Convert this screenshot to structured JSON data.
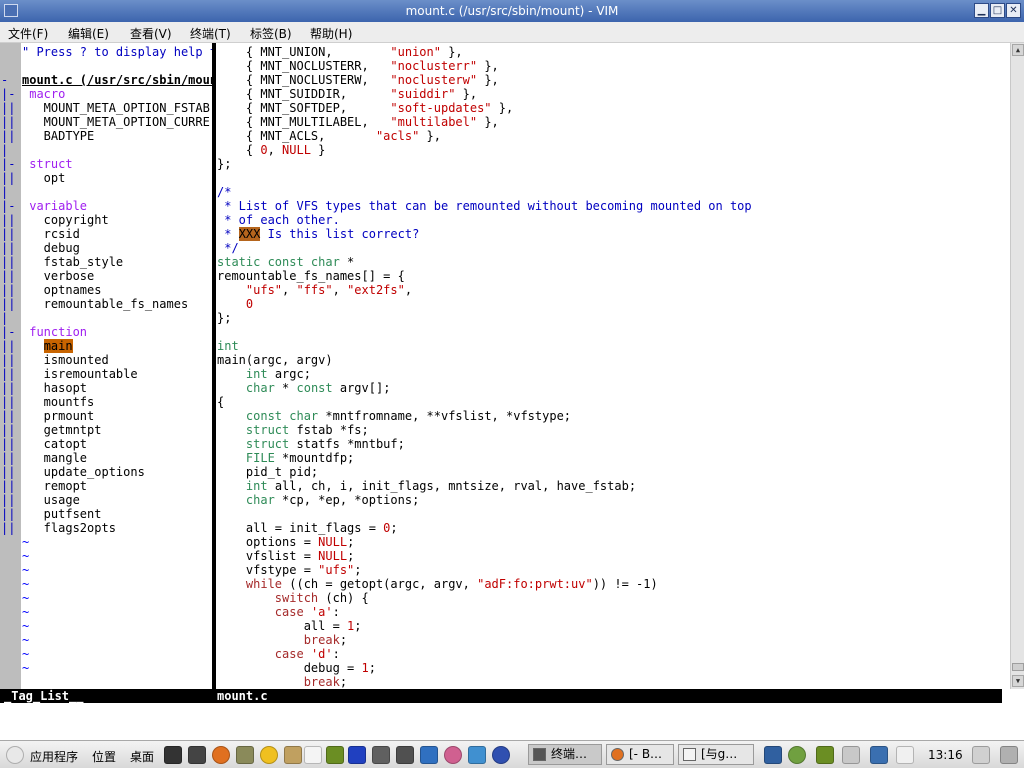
{
  "window": {
    "title": "mount.c (/usr/src/sbin/mount) - VIM",
    "controls": {
      "minimize": "▁",
      "maximize": "□",
      "close": "✕"
    }
  },
  "menu": [
    "文件(F)",
    "编辑(E)",
    "查看(V)",
    "终端(T)",
    "标签(B)",
    "帮助(H)"
  ],
  "taglist": {
    "lines": [
      {
        "fold": "",
        "text": "\" Press ? to display help t",
        "cls": "cmt"
      },
      {
        "fold": "",
        "text": "",
        "cls": ""
      },
      {
        "fold": "-",
        "text": "mount.c (/usr/src/sbin/moun",
        "cls": "hdr"
      },
      {
        "fold": "|-",
        "text": " macro",
        "cls": "tag-head"
      },
      {
        "fold": "||",
        "text": "   MOUNT_META_OPTION_FSTAB",
        "cls": ""
      },
      {
        "fold": "||",
        "text": "   MOUNT_META_OPTION_CURRE",
        "cls": ""
      },
      {
        "fold": "||",
        "text": "   BADTYPE",
        "cls": ""
      },
      {
        "fold": "|",
        "text": "",
        "cls": ""
      },
      {
        "fold": "|-",
        "text": " struct",
        "cls": "tag-head"
      },
      {
        "fold": "||",
        "text": "   opt",
        "cls": ""
      },
      {
        "fold": "|",
        "text": "",
        "cls": ""
      },
      {
        "fold": "|-",
        "text": " variable",
        "cls": "tag-head"
      },
      {
        "fold": "||",
        "text": "   copyright",
        "cls": ""
      },
      {
        "fold": "||",
        "text": "   rcsid",
        "cls": ""
      },
      {
        "fold": "||",
        "text": "   debug",
        "cls": ""
      },
      {
        "fold": "||",
        "text": "   fstab_style",
        "cls": ""
      },
      {
        "fold": "||",
        "text": "   verbose",
        "cls": ""
      },
      {
        "fold": "||",
        "text": "   optnames",
        "cls": ""
      },
      {
        "fold": "||",
        "text": "   remountable_fs_names",
        "cls": ""
      },
      {
        "fold": "|",
        "text": "",
        "cls": ""
      },
      {
        "fold": "|-",
        "text": " function",
        "cls": "tag-head"
      },
      {
        "fold": "||",
        "text": "   main",
        "cls": "cur"
      },
      {
        "fold": "||",
        "text": "   ismounted",
        "cls": ""
      },
      {
        "fold": "||",
        "text": "   isremountable",
        "cls": ""
      },
      {
        "fold": "||",
        "text": "   hasopt",
        "cls": ""
      },
      {
        "fold": "||",
        "text": "   mountfs",
        "cls": ""
      },
      {
        "fold": "||",
        "text": "   prmount",
        "cls": ""
      },
      {
        "fold": "||",
        "text": "   getmntpt",
        "cls": ""
      },
      {
        "fold": "||",
        "text": "   catopt",
        "cls": ""
      },
      {
        "fold": "||",
        "text": "   mangle",
        "cls": ""
      },
      {
        "fold": "||",
        "text": "   update_options",
        "cls": ""
      },
      {
        "fold": "||",
        "text": "   remopt",
        "cls": ""
      },
      {
        "fold": "||",
        "text": "   usage",
        "cls": ""
      },
      {
        "fold": "||",
        "text": "   putfsent",
        "cls": ""
      },
      {
        "fold": "||",
        "text": "   flags2opts",
        "cls": ""
      }
    ],
    "tilde": "~"
  },
  "code": [
    [
      [
        "    { MNT_UNION,        ",
        ""
      ],
      [
        "\"union\"",
        "str"
      ],
      [
        " },",
        ""
      ]
    ],
    [
      [
        "    { MNT_NOCLUSTERR,   ",
        ""
      ],
      [
        "\"noclusterr\"",
        "str"
      ],
      [
        " },",
        ""
      ]
    ],
    [
      [
        "    { MNT_NOCLUSTERW,   ",
        ""
      ],
      [
        "\"noclusterw\"",
        "str"
      ],
      [
        " },",
        ""
      ]
    ],
    [
      [
        "    { MNT_SUIDDIR,      ",
        ""
      ],
      [
        "\"suiddir\"",
        "str"
      ],
      [
        " },",
        ""
      ]
    ],
    [
      [
        "    { MNT_SOFTDEP,      ",
        ""
      ],
      [
        "\"soft-updates\"",
        "str"
      ],
      [
        " },",
        ""
      ]
    ],
    [
      [
        "    { MNT_MULTILABEL,   ",
        ""
      ],
      [
        "\"multilabel\"",
        "str"
      ],
      [
        " },",
        ""
      ]
    ],
    [
      [
        "    { MNT_ACLS,       ",
        ""
      ],
      [
        "\"acls\"",
        "str"
      ],
      [
        " },",
        ""
      ]
    ],
    [
      [
        "    { ",
        ""
      ],
      [
        "0",
        "str"
      ],
      [
        ", ",
        ""
      ],
      [
        "NULL",
        "str"
      ],
      [
        " }",
        ""
      ]
    ],
    [
      [
        "};",
        ""
      ]
    ],
    [
      [
        "",
        ""
      ]
    ],
    [
      [
        "/*",
        "cmt"
      ]
    ],
    [
      [
        " * List of VFS types that can be remounted without becoming mounted on top",
        "cmt"
      ]
    ],
    [
      [
        " * of each other.",
        "cmt"
      ]
    ],
    [
      [
        " * ",
        "cmt"
      ],
      [
        "XXX",
        "hlx"
      ],
      [
        " Is this list correct?",
        "cmt"
      ]
    ],
    [
      [
        " */",
        "cmt"
      ]
    ],
    [
      [
        "static const char",
        "typ"
      ],
      [
        " *",
        ""
      ]
    ],
    [
      [
        "remountable_fs_names[] = {",
        ""
      ]
    ],
    [
      [
        "    ",
        ""
      ],
      [
        "\"ufs\"",
        "str"
      ],
      [
        ", ",
        ""
      ],
      [
        "\"ffs\"",
        "str"
      ],
      [
        ", ",
        ""
      ],
      [
        "\"ext2fs\"",
        "str"
      ],
      [
        ",",
        ""
      ]
    ],
    [
      [
        "    ",
        ""
      ],
      [
        "0",
        "str"
      ]
    ],
    [
      [
        "};",
        ""
      ]
    ],
    [
      [
        "",
        ""
      ]
    ],
    [
      [
        "int",
        "typ"
      ]
    ],
    [
      [
        "main(argc, argv)",
        ""
      ]
    ],
    [
      [
        "    ",
        ""
      ],
      [
        "int",
        "typ"
      ],
      [
        " argc;",
        ""
      ]
    ],
    [
      [
        "    ",
        ""
      ],
      [
        "char",
        "typ"
      ],
      [
        " * ",
        ""
      ],
      [
        "const",
        "typ"
      ],
      [
        " argv[];",
        ""
      ]
    ],
    [
      [
        "{",
        ""
      ]
    ],
    [
      [
        "    ",
        ""
      ],
      [
        "const char",
        "typ"
      ],
      [
        " *mntfromname, **vfslist, *vfstype;",
        ""
      ]
    ],
    [
      [
        "    ",
        ""
      ],
      [
        "struct",
        "typ"
      ],
      [
        " fstab *fs;",
        ""
      ]
    ],
    [
      [
        "    ",
        ""
      ],
      [
        "struct",
        "typ"
      ],
      [
        " statfs *mntbuf;",
        ""
      ]
    ],
    [
      [
        "    ",
        ""
      ],
      [
        "FILE",
        "typ"
      ],
      [
        " *mountdfp;",
        ""
      ]
    ],
    [
      [
        "    pid_t pid;",
        ""
      ]
    ],
    [
      [
        "    ",
        ""
      ],
      [
        "int",
        "typ"
      ],
      [
        " all, ch, i, init_flags, mntsize, rval, have_fstab;",
        ""
      ]
    ],
    [
      [
        "    ",
        ""
      ],
      [
        "char",
        "typ"
      ],
      [
        " *cp, *ep, *options;",
        ""
      ]
    ],
    [
      [
        "",
        ""
      ]
    ],
    [
      [
        "    all = init_flags = ",
        ""
      ],
      [
        "0",
        "str"
      ],
      [
        ";",
        ""
      ]
    ],
    [
      [
        "    options = ",
        ""
      ],
      [
        "NULL",
        "str"
      ],
      [
        ";",
        ""
      ]
    ],
    [
      [
        "    vfslist = ",
        ""
      ],
      [
        "NULL",
        "str"
      ],
      [
        ";",
        ""
      ]
    ],
    [
      [
        "    vfstype = ",
        ""
      ],
      [
        "\"ufs\"",
        "str"
      ],
      [
        ";",
        ""
      ]
    ],
    [
      [
        "    ",
        ""
      ],
      [
        "while",
        "kw"
      ],
      [
        " ((ch = getopt(argc, argv, ",
        ""
      ],
      [
        "\"adF:fo:prwt:uv\"",
        "str"
      ],
      [
        ")) != -1)",
        ""
      ]
    ],
    [
      [
        "        ",
        ""
      ],
      [
        "switch",
        "kw"
      ],
      [
        " (ch) {",
        ""
      ]
    ],
    [
      [
        "        ",
        ""
      ],
      [
        "case",
        "kw"
      ],
      [
        " ",
        ""
      ],
      [
        "'a'",
        "str"
      ],
      [
        ":",
        ""
      ]
    ],
    [
      [
        "            all = ",
        ""
      ],
      [
        "1",
        "str"
      ],
      [
        ";",
        ""
      ]
    ],
    [
      [
        "            ",
        ""
      ],
      [
        "break",
        "kw"
      ],
      [
        ";",
        ""
      ]
    ],
    [
      [
        "        ",
        ""
      ],
      [
        "case",
        "kw"
      ],
      [
        " ",
        ""
      ],
      [
        "'d'",
        "str"
      ],
      [
        ":",
        ""
      ]
    ],
    [
      [
        "            debug = ",
        ""
      ],
      [
        "1",
        "str"
      ],
      [
        ";",
        ""
      ]
    ],
    [
      [
        "            ",
        ""
      ],
      [
        "break",
        "kw"
      ],
      [
        ";",
        ""
      ]
    ]
  ],
  "status": {
    "left": "_Tag_List__",
    "right": "mount.c"
  },
  "taskbar": {
    "menus": [
      "应用程序",
      "位置",
      "桌面"
    ],
    "tasks": [
      "终端…",
      "[- B…",
      "[与g…"
    ],
    "clock": "13:16"
  },
  "colors": {
    "comment": "#0000c0",
    "string": "#c00000",
    "type": "#2e8b57",
    "keyword": "#a52a2a",
    "taghead": "#a020f0",
    "highlight": "#c86400"
  }
}
